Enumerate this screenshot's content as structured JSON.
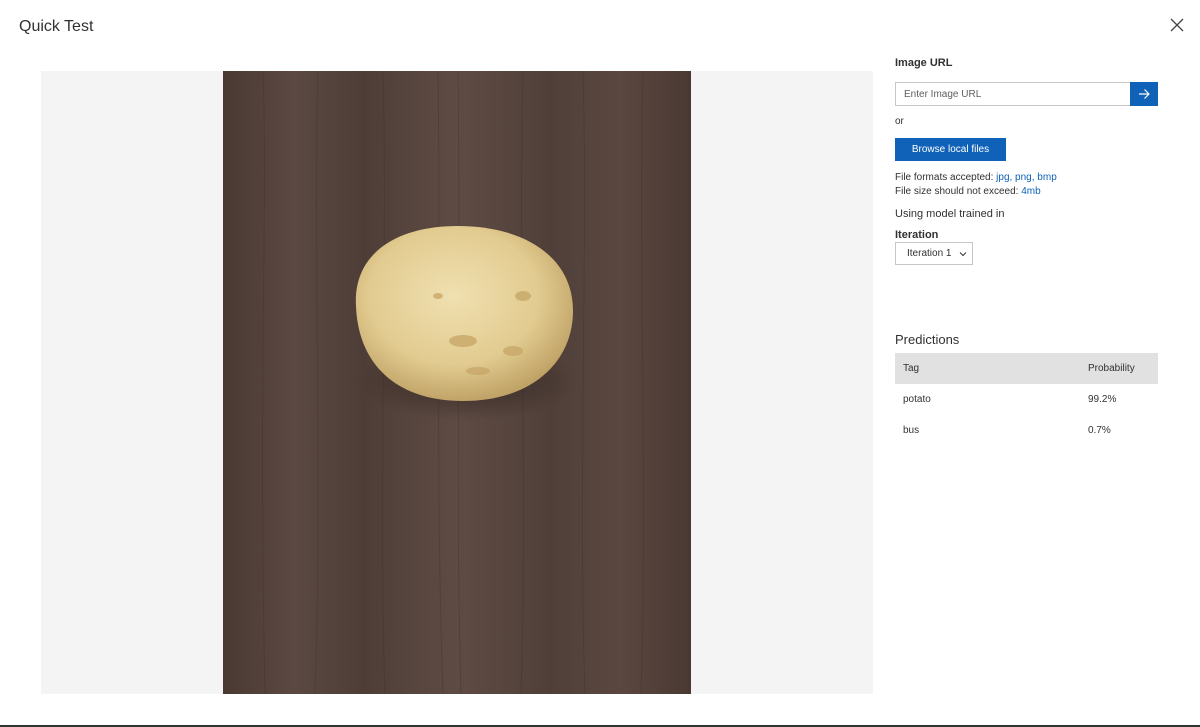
{
  "header": {
    "title": "Quick Test"
  },
  "image_url": {
    "label": "Image URL",
    "placeholder": "Enter Image URL"
  },
  "or_text": "or",
  "browse_label": "Browse local files",
  "file_info": {
    "formats_prefix": "File formats accepted: ",
    "formats": "jpg, png, bmp",
    "size_prefix": "File size should not exceed: ",
    "size": "4mb"
  },
  "model": {
    "trained_label": "Using model trained in",
    "iteration_label": "Iteration",
    "iteration_value": "Iteration 1"
  },
  "predictions": {
    "title": "Predictions",
    "columns": [
      "Tag",
      "Probability"
    ],
    "rows": [
      {
        "tag": "potato",
        "probability": "99.2%"
      },
      {
        "tag": "bus",
        "probability": "0.7%"
      }
    ]
  },
  "colors": {
    "accent": "#0f62b8",
    "table_header": "#e1e1e1",
    "preview_bg": "#f4f4f4"
  },
  "icons": {
    "close": "close-icon",
    "submit": "arrow-right-icon",
    "dropdown": "chevron-down-icon"
  }
}
